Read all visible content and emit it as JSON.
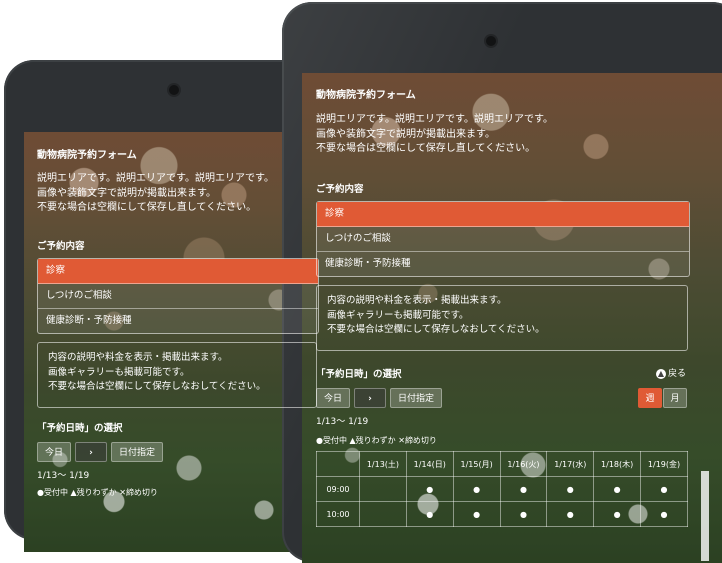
{
  "form": {
    "title": "動物病院予約フォーム",
    "description": [
      "説明エリアです。説明エリアです。説明エリアです。",
      "画像や装飾文字で説明が掲載出来ます。",
      "不要な場合は空欄にして保存し直してください。"
    ],
    "section_reservation": "ご予約内容",
    "menu_items": [
      "診察",
      "しつけのご相談",
      "健康診断・予防接種"
    ],
    "info_text": [
      "内容の説明や料金を表示・掲載出来ます。",
      "画像ギャラリーも掲載可能です。",
      "不要な場合は空欄にして保存しなおしてください。"
    ],
    "section_datetime": "「予約日時」の選択",
    "back_label": "戻る",
    "today_label": "今日",
    "next_label": "›",
    "date_pick_label": "日付指定",
    "week_label": "週",
    "month_label": "月",
    "range_label": "1/13～ 1/19",
    "legend": {
      "available": "●受付中",
      "few": "▲残りわずか",
      "closed": "✕締め切り"
    }
  },
  "schedule": {
    "columns": [
      "1/13(土)",
      "1/14(日)",
      "1/15(月)",
      "1/16(火)",
      "1/17(水)",
      "1/18(木)",
      "1/19(金)"
    ],
    "rows": [
      {
        "time": "09:00",
        "slots": [
          "",
          "●",
          "●",
          "●",
          "●",
          "●",
          "●"
        ]
      },
      {
        "time": "10:00",
        "slots": [
          "",
          "●",
          "●",
          "●",
          "●",
          "●",
          "●"
        ]
      }
    ]
  },
  "colors": {
    "accent": "#e05a35",
    "bezel": "#2e3134"
  }
}
